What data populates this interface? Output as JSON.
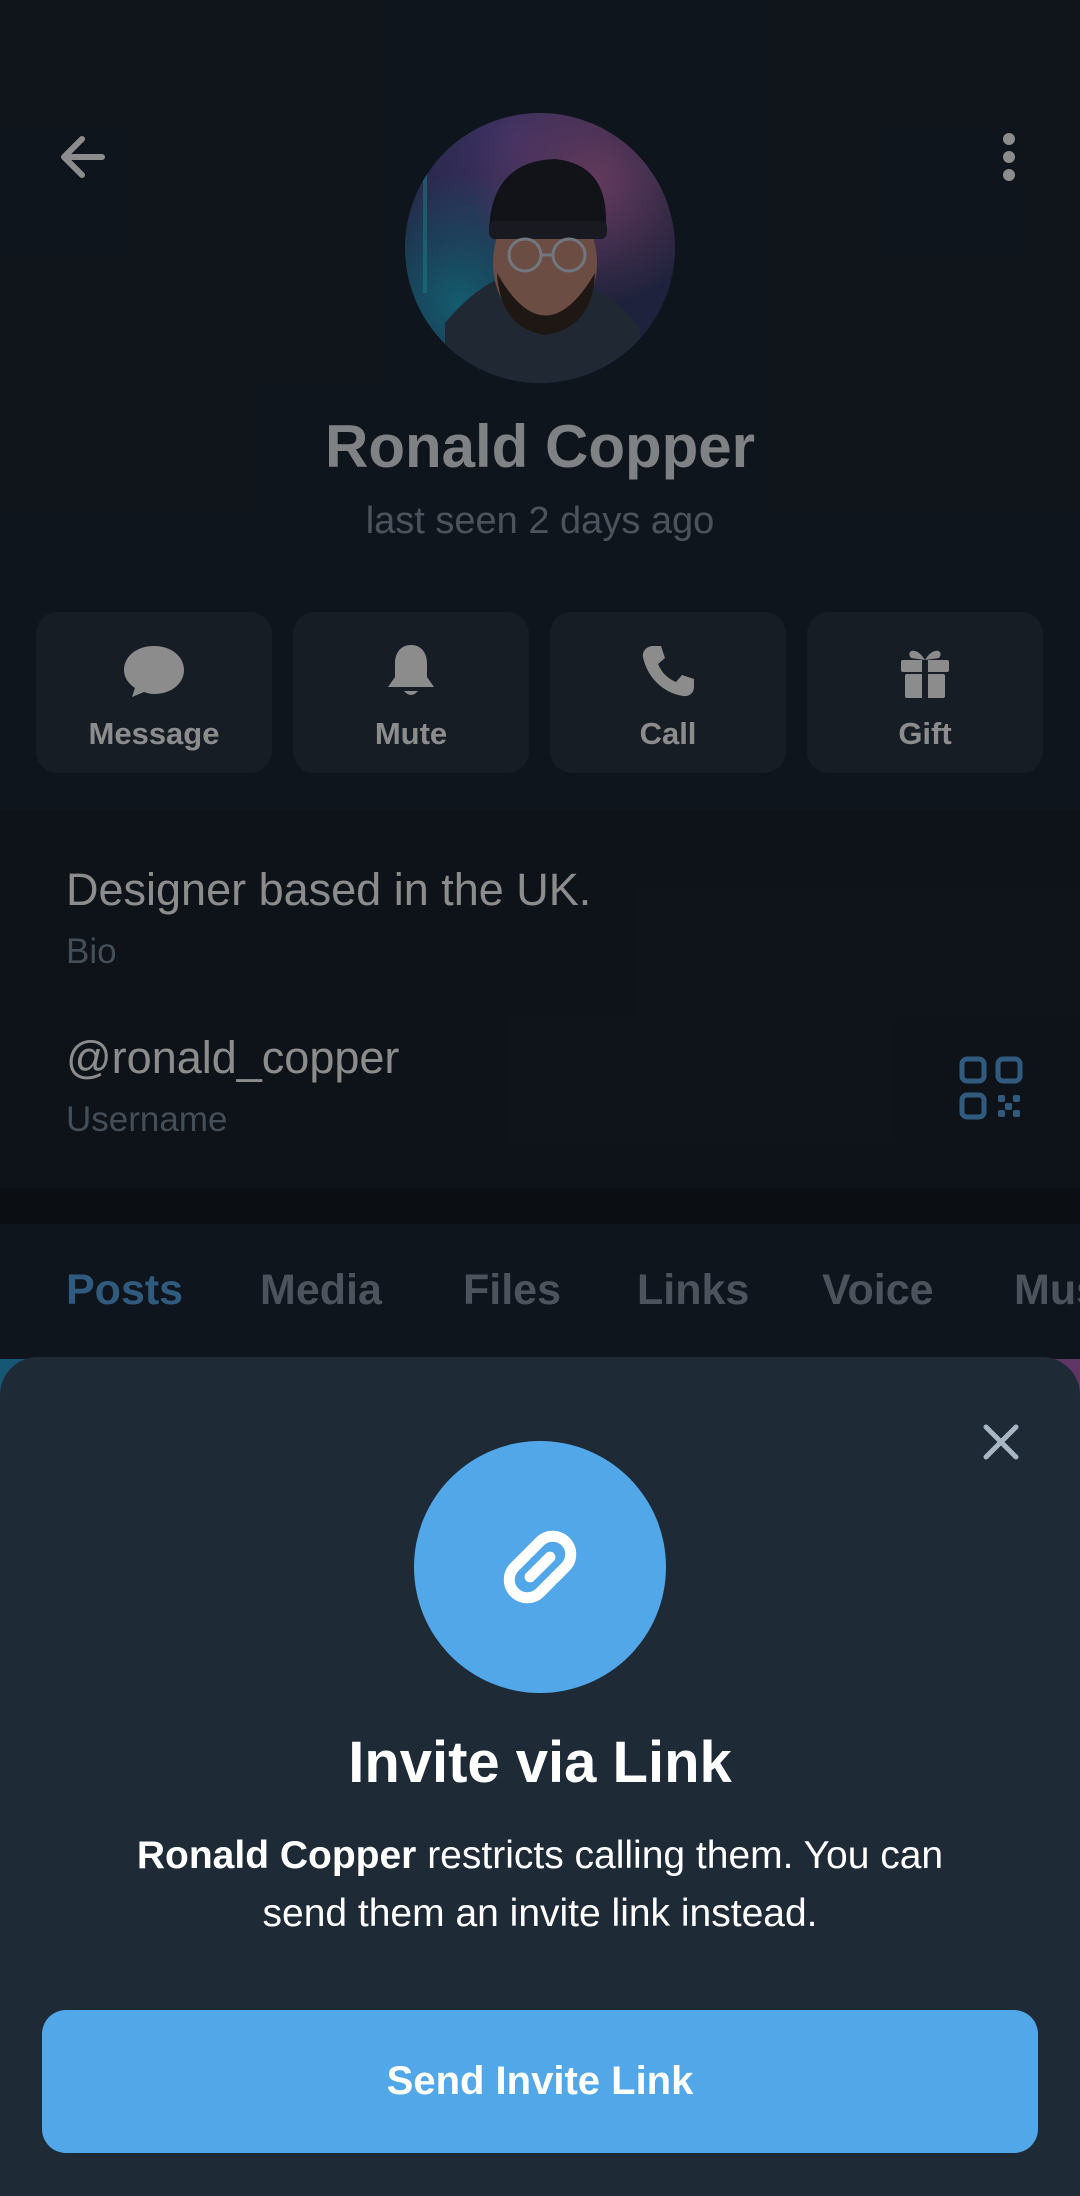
{
  "profile": {
    "name": "Ronald Copper",
    "status": "last seen 2 days ago",
    "actions": [
      {
        "label": "Message",
        "icon": "chat-bubble-icon"
      },
      {
        "label": "Mute",
        "icon": "bell-icon"
      },
      {
        "label": "Call",
        "icon": "phone-icon"
      },
      {
        "label": "Gift",
        "icon": "gift-icon"
      }
    ],
    "bio": {
      "value": "Designer based in the UK.",
      "label": "Bio"
    },
    "username": {
      "value": "@ronald_copper",
      "label": "Username"
    },
    "tabs": [
      "Posts",
      "Media",
      "Files",
      "Links",
      "Voice",
      "Music"
    ],
    "active_tab": "Posts"
  },
  "sheet": {
    "title": "Invite via Link",
    "desc_name": "Ronald Copper",
    "desc_rest": " restricts calling them. You can send them an invite link instead.",
    "button_label": "Send Invite Link"
  },
  "colors": {
    "accent": "#52a7e8",
    "background": "#1d2733",
    "sheet": "#1f2a37"
  }
}
